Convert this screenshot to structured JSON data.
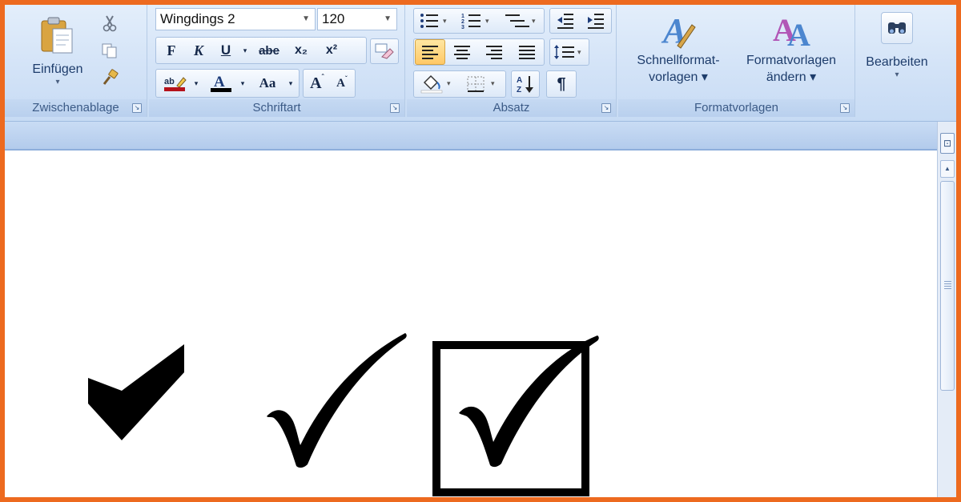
{
  "ribbon": {
    "clipboard": {
      "label": "Zwischenablage",
      "paste_label": "Einfügen",
      "paste_dropdown": "▾"
    },
    "font": {
      "label": "Schriftart",
      "font_name": "Wingdings 2",
      "font_size": "120",
      "bold": "F",
      "italic": "K",
      "underline": "U",
      "strikethrough": "abe",
      "subscript": "x₂",
      "superscript": "x²",
      "change_case": "Aa",
      "grow_font": "A",
      "shrink_font": "A"
    },
    "paragraph": {
      "label": "Absatz",
      "pilcrow": "¶"
    },
    "styles": {
      "label": "Formatvorlagen",
      "quick_styles_line1": "Schnellformat-",
      "quick_styles_line2": "vorlagen ▾",
      "change_styles_line1": "Formatvorlagen",
      "change_styles_line2": "ändern ▾"
    },
    "editing": {
      "label": "Bearbeiten",
      "dropdown": "▾"
    }
  },
  "colors": {
    "border_accent": "#ed6a1f",
    "ribbon_bg": "#d3e3f7",
    "highlight_color": "#b5121b",
    "font_color": "#000000",
    "active_button": "#ffc866"
  },
  "document": {
    "glyphs": [
      "heavy-check-mark",
      "check-mark",
      "checked-box"
    ]
  }
}
